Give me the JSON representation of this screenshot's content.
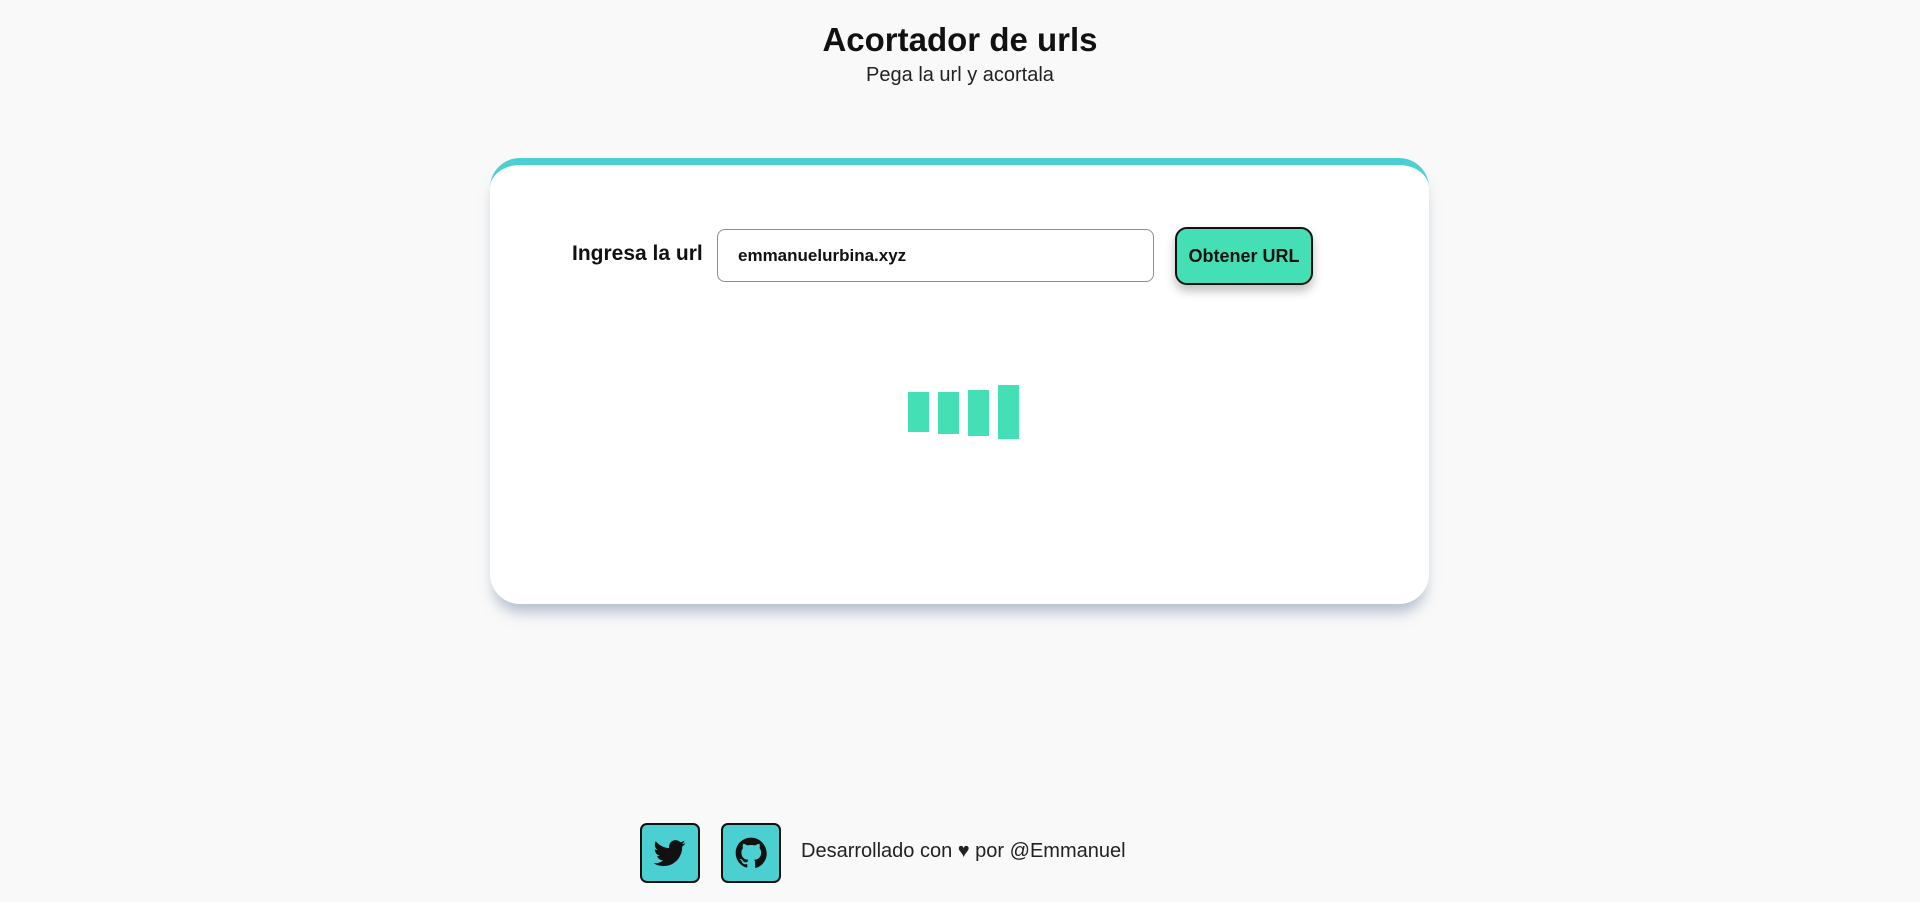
{
  "header": {
    "title": "Acortador de urls",
    "subtitle": "Pega la url y acortala"
  },
  "form": {
    "label": "Ingresa la url",
    "input_value": "emmanuelurbina.xyz",
    "submit_label": "Obtener URL"
  },
  "loader": {
    "bars": 4,
    "color": "#45dfb6"
  },
  "footer": {
    "credit": "Desarrollado con ♥ por @Emmanuel",
    "links": [
      {
        "icon": "twitter-icon"
      },
      {
        "icon": "github-icon"
      }
    ]
  },
  "colors": {
    "accent": "#45dfb6",
    "card_top": "#4ccfd0",
    "social_bg": "#4ccfd0",
    "background": "#f9f9f9"
  }
}
